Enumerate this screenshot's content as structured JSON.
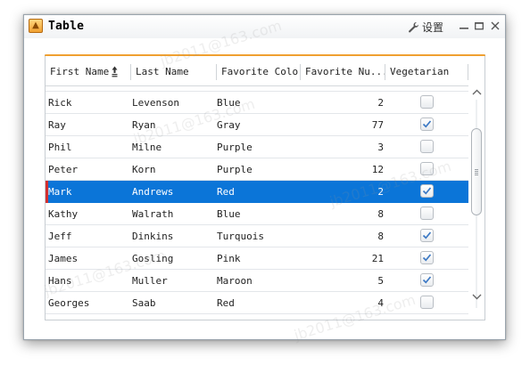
{
  "window": {
    "title": "Table",
    "settings_label": "设置",
    "icons": [
      "table-app-icon",
      "wrench-icon",
      "minimize-icon",
      "maximize-icon",
      "close-icon"
    ]
  },
  "table": {
    "columns": [
      {
        "label": "First Name",
        "sorted": "ascending"
      },
      {
        "label": "Last Name"
      },
      {
        "label": "Favorite Color"
      },
      {
        "label": "Favorite Nu..."
      },
      {
        "label": "Vegetarian"
      }
    ],
    "rows": [
      {
        "first": "Rick",
        "last": "Levenson",
        "color": "Blue",
        "number": "2",
        "vegetarian": false
      },
      {
        "first": "Ray",
        "last": "Ryan",
        "color": "Gray",
        "number": "77",
        "vegetarian": true
      },
      {
        "first": "Phil",
        "last": "Milne",
        "color": "Purple",
        "number": "3",
        "vegetarian": false
      },
      {
        "first": "Peter",
        "last": "Korn",
        "color": "Purple",
        "number": "12",
        "vegetarian": false
      },
      {
        "first": "Mark",
        "last": "Andrews",
        "color": "Red",
        "number": "2",
        "vegetarian": true,
        "selected": true
      },
      {
        "first": "Kathy",
        "last": "Walrath",
        "color": "Blue",
        "number": "8",
        "vegetarian": false
      },
      {
        "first": "Jeff",
        "last": "Dinkins",
        "color": "Turquois",
        "number": "8",
        "vegetarian": true
      },
      {
        "first": "James",
        "last": "Gosling",
        "color": "Pink",
        "number": "21",
        "vegetarian": true
      },
      {
        "first": "Hans",
        "last": "Muller",
        "color": "Maroon",
        "number": "5",
        "vegetarian": true
      },
      {
        "first": "Georges",
        "last": "Saab",
        "color": "Red",
        "number": "4",
        "vegetarian": false
      }
    ]
  },
  "watermark_text": "jb2011@163.com",
  "colors": {
    "selection": "#0b75d8",
    "selection_marker": "#d32f2f",
    "accent_line": "#f0a030",
    "check_mark": "#3b78c4"
  }
}
